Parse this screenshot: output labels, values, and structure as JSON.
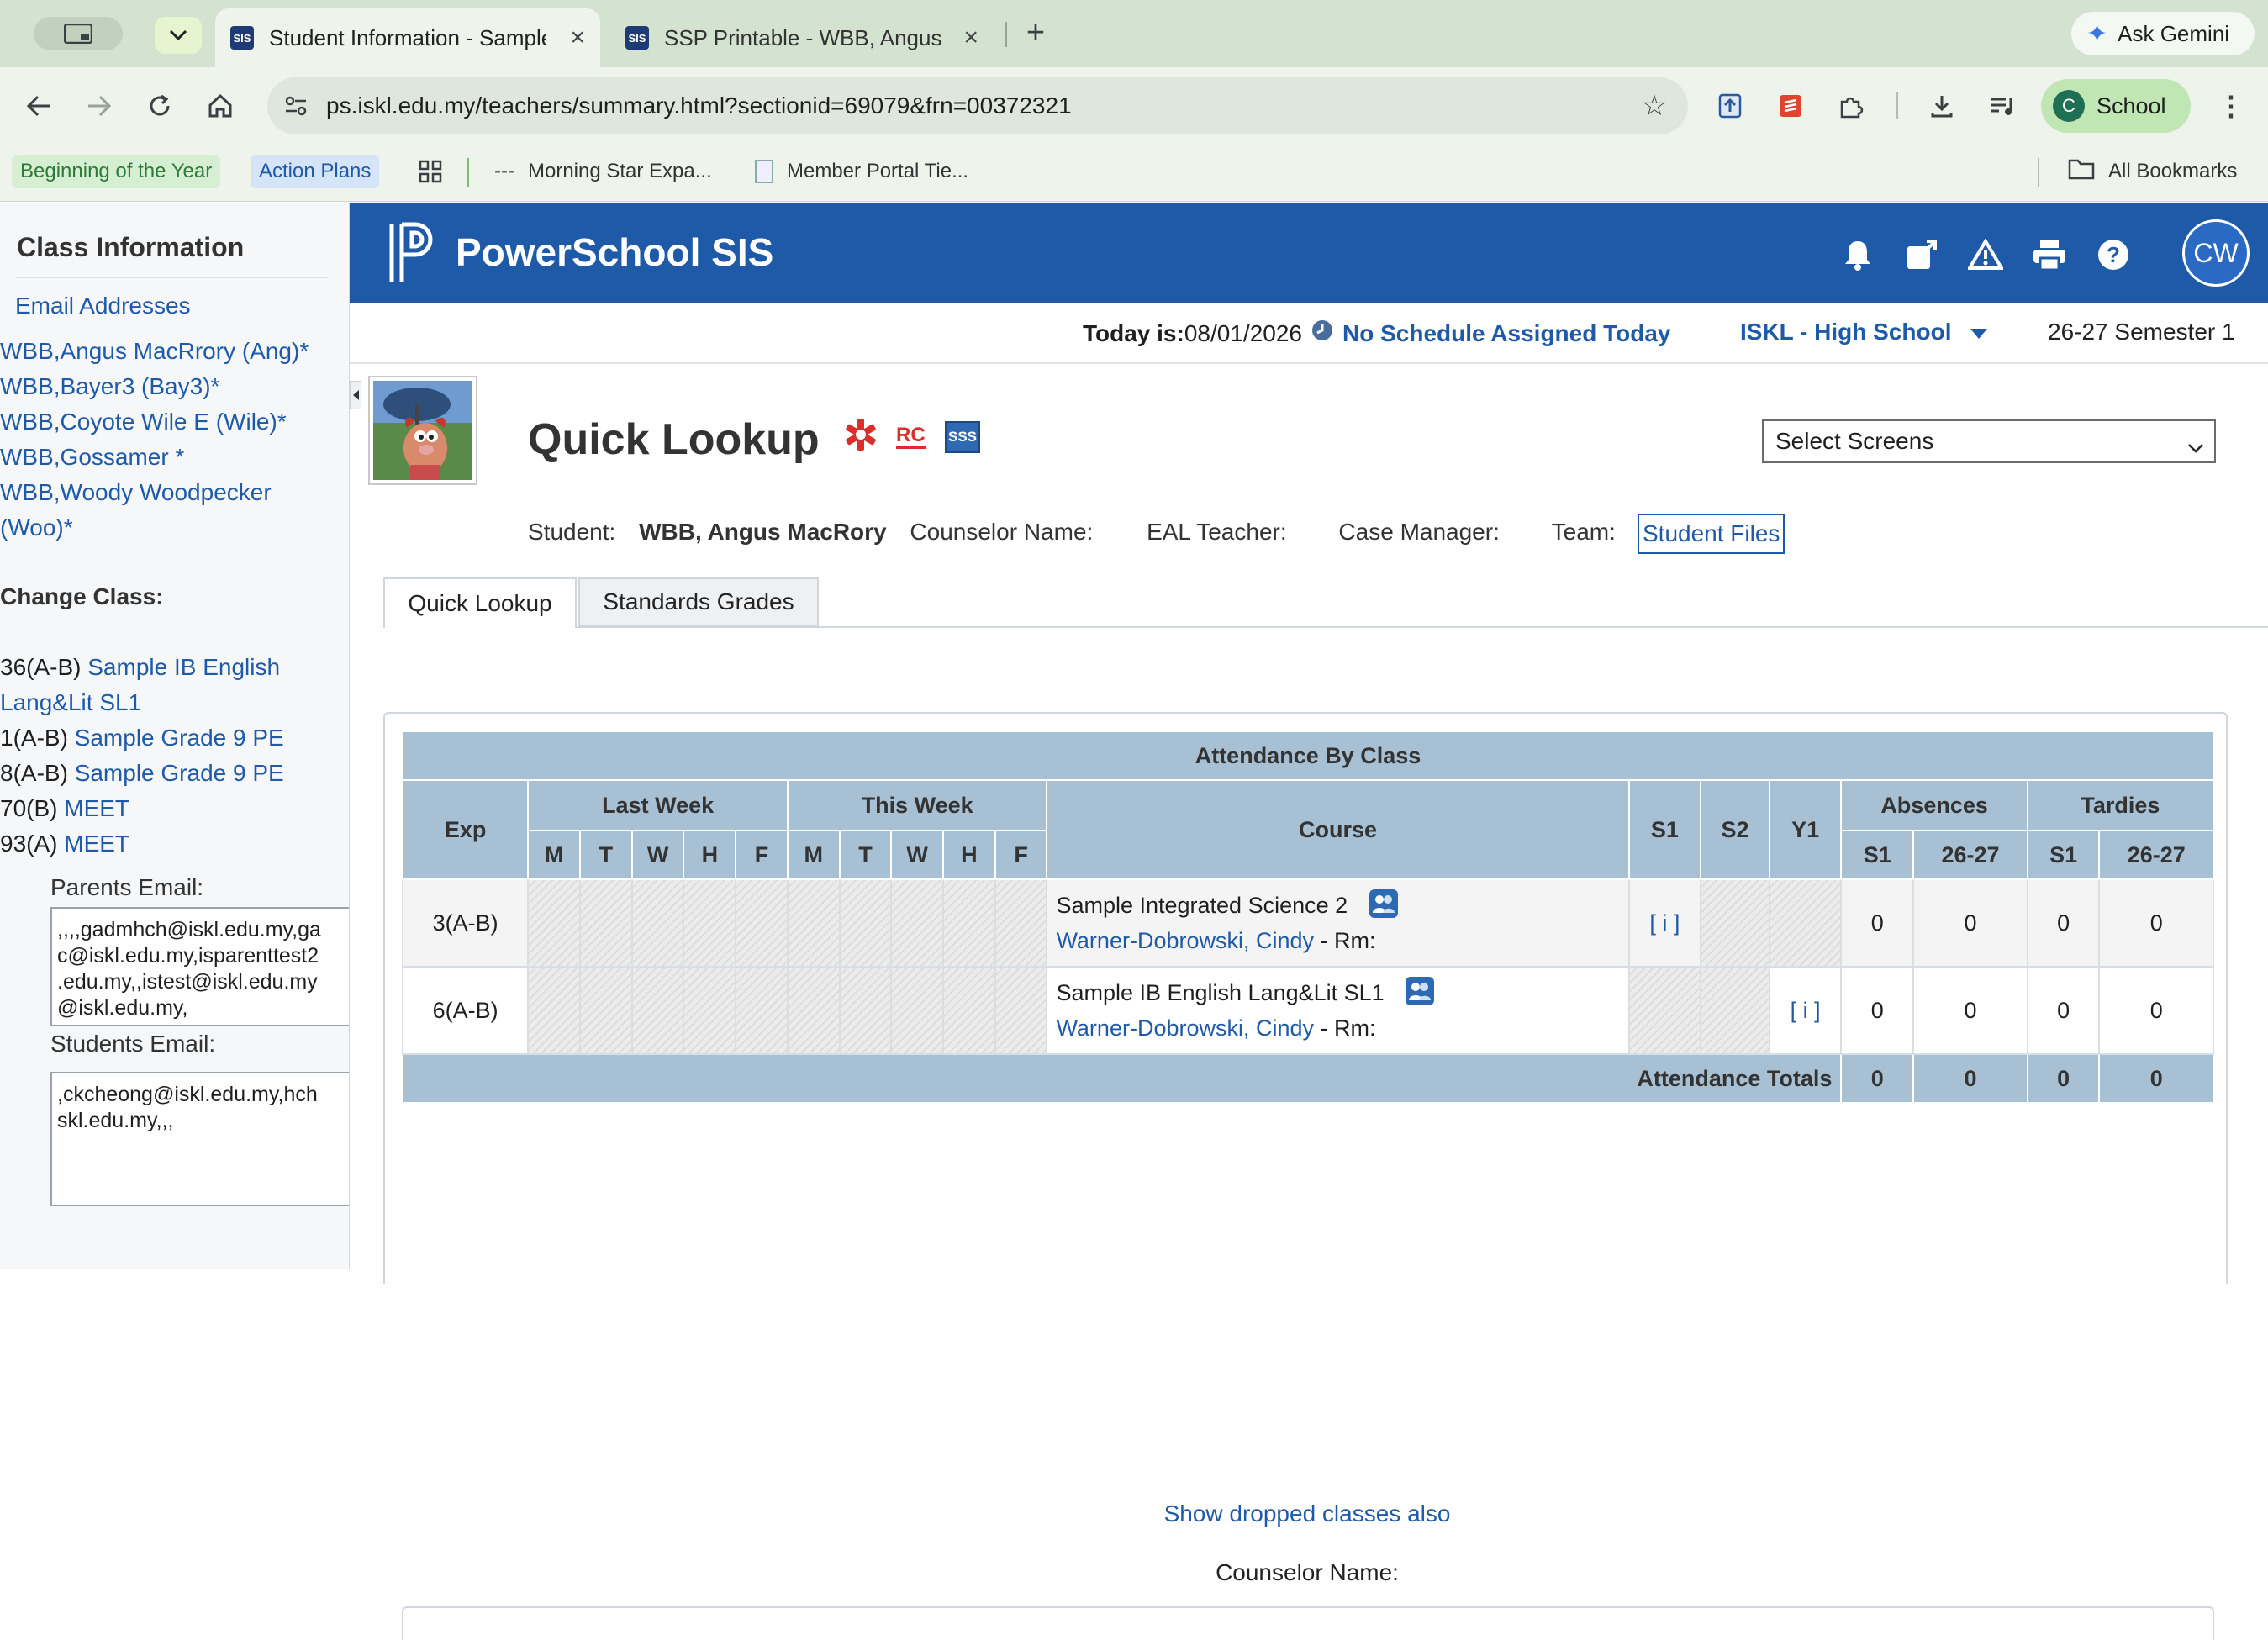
{
  "browser": {
    "tabs": [
      {
        "favicon": "SIS",
        "title": "Student Information - Sample",
        "active": true
      },
      {
        "favicon": "SIS",
        "title": "SSP Printable - WBB, Angus M",
        "active": false
      }
    ],
    "new_tab": "+",
    "ask_gemini": "Ask Gemini",
    "url": "ps.iskl.edu.my/teachers/summary.html?sectionid=69079&frn=00372321",
    "profile_initial": "C",
    "profile_label": "School",
    "bookmarks": [
      "Beginning of the Year",
      "Action Plans",
      "Morning Star Expa...",
      "Member Portal Tie...",
      "All Bookmarks"
    ]
  },
  "sidebar": {
    "title": "Class Information",
    "email_link": "Email Addresses",
    "students": [
      "WBB,Angus MacRrory (Ang)*",
      "WBB,Bayer3 (Bay3)*",
      "WBB,Coyote Wile E (Wile)*",
      "WBB,Gossamer *",
      "WBB,Woody Woodpecker",
      "(Woo)*"
    ],
    "change_class_label": "Change Class:",
    "classes": [
      {
        "period": "36(A-B)",
        "name": "Sample IB English"
      },
      {
        "period": "",
        "name": "Lang&Lit SL1"
      },
      {
        "period": "1(A-B)",
        "name": "Sample Grade 9 PE"
      },
      {
        "period": "8(A-B)",
        "name": "Sample Grade 9 PE"
      },
      {
        "period": "70(B)",
        "name": "MEET"
      },
      {
        "period": "93(A)",
        "name": "MEET"
      }
    ],
    "parents_email_label": "Parents Email:",
    "parents_email_lines": [
      ",,,,gadmhch@iskl.edu.my,ga",
      "c@iskl.edu.my,isparenttest2",
      ".edu.my,,istest@iskl.edu.my",
      "@iskl.edu.my,"
    ],
    "students_email_label": "Students Email:",
    "students_email_lines": [
      ",ckcheong@iskl.edu.my,hch",
      "skl.edu.my,,,"
    ]
  },
  "header": {
    "brand": "PowerSchool SIS",
    "user_initials": "CW",
    "today_label": "Today is:",
    "today_date": "08/01/2026",
    "schedule_note": "No Schedule Assigned Today",
    "school": "ISKL - High School",
    "term": "26-27 Semester 1"
  },
  "student": {
    "page_title": "Quick Lookup",
    "badge_rc": "RC",
    "badge_sss": "SSS",
    "select_screens": "Select Screens",
    "student_label": "Student:",
    "student_name": "WBB, Angus MacRory",
    "counselor_label": "Counselor Name:",
    "eal_label": "EAL Teacher:",
    "case_manager_label": "Case Manager:",
    "team_label": "Team:",
    "student_files": "Student Files"
  },
  "tabs": [
    "Quick Lookup",
    "Standards Grades"
  ],
  "attendance": {
    "title": "Attendance By Class",
    "headers": {
      "exp": "Exp",
      "last_week": "Last Week",
      "this_week": "This Week",
      "course": "Course",
      "s1": "S1",
      "s2": "S2",
      "y1": "Y1",
      "absences": "Absences",
      "tardies": "Tardies",
      "days": [
        "M",
        "T",
        "W",
        "H",
        "F",
        "M",
        "T",
        "W",
        "H",
        "F"
      ],
      "abs_sub": [
        "S1",
        "26-27"
      ],
      "tard_sub": [
        "S1",
        "26-27"
      ]
    },
    "rows": [
      {
        "exp": "3(A-B)",
        "course": "Sample Integrated Science 2",
        "teacher": "Warner-Dobrowski, Cindy",
        "rm": " - Rm:",
        "s1": "[ i ]",
        "s2": "",
        "y1": "",
        "abs_s1": "0",
        "abs_yr": "0",
        "tard_s1": "0",
        "tard_yr": "0"
      },
      {
        "exp": "6(A-B)",
        "course": "Sample IB English Lang&Lit SL1",
        "teacher": "Warner-Dobrowski, Cindy",
        "rm": " - Rm:",
        "s1": "",
        "s2": "",
        "y1": "[ i ]",
        "abs_s1": "0",
        "abs_yr": "0",
        "tard_s1": "0",
        "tard_yr": "0"
      }
    ],
    "totals_label": "Attendance Totals",
    "totals": [
      "0",
      "0",
      "0",
      "0"
    ]
  },
  "show_dropped": "Show dropped classes also",
  "counselor_footer": "Counselor Name:"
}
